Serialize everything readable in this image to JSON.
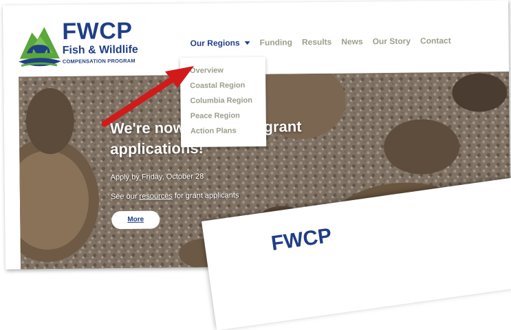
{
  "logo": {
    "title": "FWCP",
    "subtitle": "Fish & Wildlife",
    "tagline": "COMPENSATION PROGRAM"
  },
  "nav": {
    "items": [
      {
        "label": "Our Regions",
        "active": true
      },
      {
        "label": "Funding"
      },
      {
        "label": "Results"
      },
      {
        "label": "News"
      },
      {
        "label": "Our Story"
      },
      {
        "label": "Contact"
      }
    ]
  },
  "dropdown": {
    "items": [
      "Overview",
      "Coastal Region",
      "Columbia Region",
      "Peace Region",
      "Action Plans"
    ]
  },
  "hero": {
    "title": "We're now accepting grant applications!",
    "deadline": "Apply by Friday, October 28",
    "resources_prefix": "See our ",
    "resources_link": "resources",
    "resources_suffix": " for grant applicants",
    "button": "More"
  },
  "second_screenshot": {
    "logo_text": "FWCP"
  },
  "colors": {
    "brand_blue": "#1f3f86",
    "nav_gray": "#9aa08b",
    "arrow_red": "#d21a1a"
  }
}
